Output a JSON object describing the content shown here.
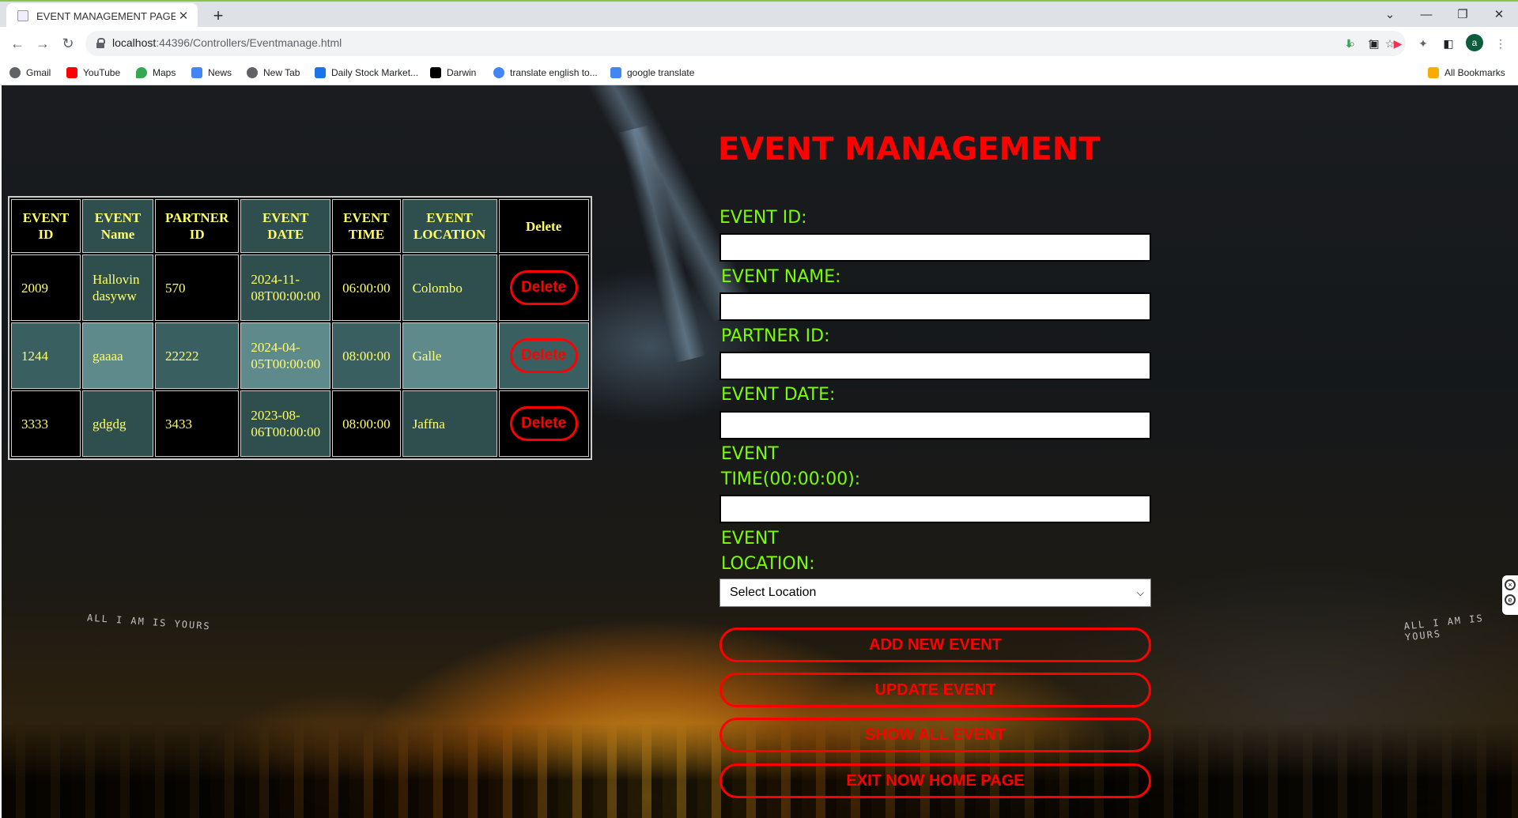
{
  "browser": {
    "tab_title": "EVENT MANAGEMENT PAGE",
    "url_host": "localhost",
    "url_path": ":44396/Controllers/Eventmanage.html",
    "profile_initial": "a",
    "bookmarks": [
      {
        "label": "Gmail",
        "color": "#5f6368"
      },
      {
        "label": "YouTube",
        "color": "#ff0000"
      },
      {
        "label": "Maps",
        "color": "#34a853"
      },
      {
        "label": "News",
        "color": "#4285f4"
      },
      {
        "label": "New Tab",
        "color": "#5f6368"
      },
      {
        "label": "Daily Stock Market...",
        "color": "#1a73e8"
      },
      {
        "label": "Darwin",
        "color": "#000000"
      },
      {
        "label": "translate english to...",
        "color": "#4285f4"
      },
      {
        "label": "google translate",
        "color": "#4285f4"
      }
    ],
    "all_bookmarks": "All Bookmarks"
  },
  "table": {
    "headers": [
      "EVENT ID",
      "EVENT Name",
      "PARTNER ID",
      "EVENT DATE",
      "EVENT TIME",
      "EVENT LOCATION",
      "Delete"
    ],
    "rows": [
      {
        "id": "2009",
        "name": "Hallovin dasyww",
        "partner": "570",
        "date": "2024-11-08T00:00:00",
        "time": "06:00:00",
        "location": "Colombo",
        "action": "Delete"
      },
      {
        "id": "1244",
        "name": "gaaaa",
        "partner": "22222",
        "date": "2024-04-05T00:00:00",
        "time": "08:00:00",
        "location": "Galle",
        "action": "Delete"
      },
      {
        "id": "3333",
        "name": "gdgdg",
        "partner": "3433",
        "date": "2023-08-06T00:00:00",
        "time": "08:00:00",
        "location": "Jaffna",
        "action": "Delete"
      }
    ]
  },
  "form": {
    "title": "EVENT MANAGEMENT",
    "labels": {
      "event_id": "EVENT ID:",
      "event_name": "EVENT NAME:",
      "partner_id": "PARTNER ID:",
      "event_date": "EVENT DATE:",
      "event_time_1": "EVENT",
      "event_time_2": "TIME(00:00:00):",
      "event_location_1": "EVENT",
      "event_location_2": "LOCATION:"
    },
    "location_select": "Select Location",
    "buttons": {
      "add": "ADD NEW EVENT",
      "update": "UPDATE EVENT",
      "show_all": "SHOW ALL EVENT",
      "exit": "EXIT NOW HOME PAGE"
    }
  },
  "background_text": {
    "left": "ALL I AM IS YOURS",
    "right": "ALL I AM IS YOURS"
  },
  "colors": {
    "title": "#ff0000",
    "labels": "#7cfc00",
    "table_text": "#ffff66",
    "buttons": "#ff0000"
  }
}
